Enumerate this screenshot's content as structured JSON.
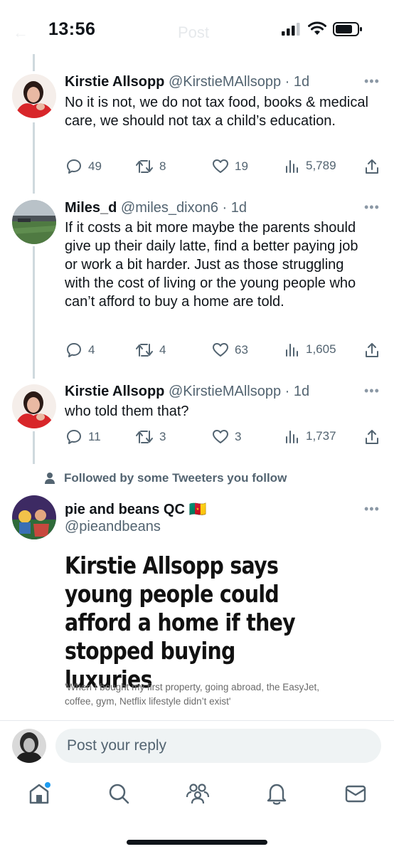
{
  "status_bar": {
    "time": "13:56",
    "ghost_title": "Post"
  },
  "tweets": [
    {
      "name": "Kirstie Allsopp",
      "handle": "@KirstieMAllsopp · 1d",
      "text": "No it is not, we do not tax food, books & medical care, we should not tax a child’s education.",
      "replies": "49",
      "retweets": "8",
      "likes": "19",
      "views": "5,789"
    },
    {
      "name": "Miles_d",
      "handle": "@miles_dixon6 · 1d",
      "text": "If it costs a bit more maybe the parents should give up their daily latte, find a better paying job or work a bit harder. Just as those struggling with the cost of living or the young people who can’t afford to buy a home are told.",
      "replies": "4",
      "retweets": "4",
      "likes": "63",
      "views": "1,605"
    },
    {
      "name": "Kirstie Allsopp",
      "handle": "@KirstieMAllsopp · 1d",
      "text": "who told them that?",
      "replies": "11",
      "retweets": "3",
      "likes": "3",
      "views": "1,737"
    }
  ],
  "followed_notice": "Followed by some Tweeters you follow",
  "main_tweet": {
    "name": "pie and beans QC",
    "flag": "🇨🇲",
    "handle": "@pieandbeans",
    "headline": "Kirstie Allsopp says young people could afford a home if they stopped buying luxuries",
    "subtext": "'When I bought my first property, going abroad, the EasyJet, coffee, gym, Netflix lifestyle didn’t exist'"
  },
  "reply": {
    "placeholder": "Post your reply"
  },
  "nav": [
    "home-icon",
    "search-icon",
    "communities-icon",
    "notifications-icon",
    "messages-icon"
  ],
  "colors": {
    "text": "#0f1419",
    "secondary": "#536471",
    "accent": "#1d9bf0",
    "thread_line": "#cfd9de"
  }
}
